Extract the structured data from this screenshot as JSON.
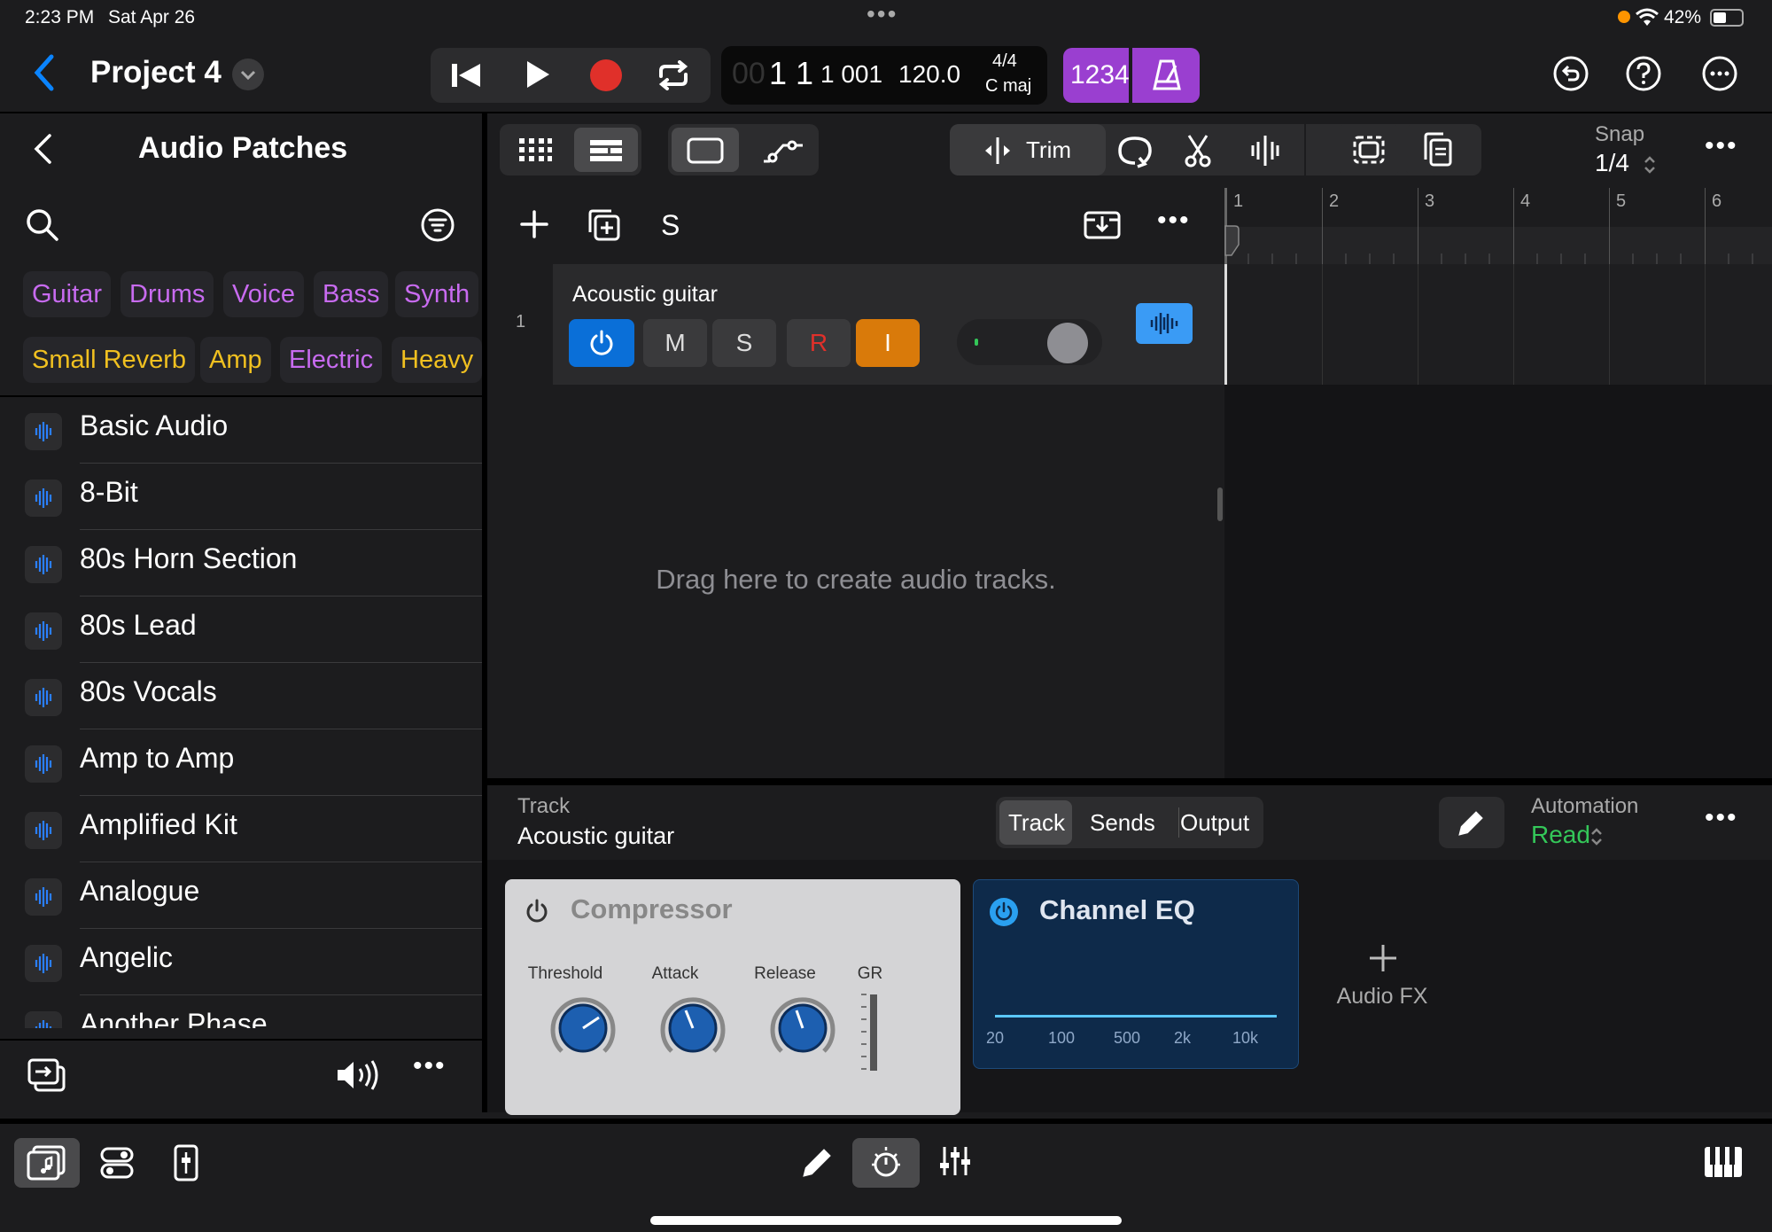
{
  "status_bar": {
    "time": "2:23 PM",
    "date": "Sat Apr 26",
    "battery": "42%"
  },
  "header": {
    "project_title": "Project 4",
    "lcd": {
      "bars_dim": "00",
      "position": "1 1",
      "sub": "1 001",
      "tempo": "120.0",
      "signature": "4/4",
      "key": "C maj"
    },
    "count_in": "1234"
  },
  "left_panel": {
    "title": "Audio Patches",
    "tags": [
      {
        "label": "Guitar",
        "color": "#c86bf0"
      },
      {
        "label": "Drums",
        "color": "#c86bf0"
      },
      {
        "label": "Voice",
        "color": "#c86bf0"
      },
      {
        "label": "Bass",
        "color": "#c86bf0"
      },
      {
        "label": "Synth",
        "color": "#c86bf0"
      },
      {
        "label": "Small Reverb",
        "color": "#f0c020"
      },
      {
        "label": "Amp",
        "color": "#f0c020"
      },
      {
        "label": "Electric",
        "color": "#c86bf0"
      },
      {
        "label": "Heavy",
        "color": "#f0c020"
      }
    ],
    "patches": [
      "Basic Audio",
      "8-Bit",
      "80s Horn Section",
      "80s Lead",
      "80s Vocals",
      "Amp to Amp",
      "Amplified Kit",
      "Analogue",
      "Angelic",
      "Another Phase"
    ]
  },
  "toolbar": {
    "trim_label": "Trim",
    "snap_label": "Snap",
    "snap_value": "1/4"
  },
  "track_header": {
    "solo_label": "S"
  },
  "ruler": {
    "bars": [
      "1",
      "2",
      "3",
      "4",
      "5",
      "6"
    ]
  },
  "track": {
    "number": "1",
    "name": "Acoustic guitar",
    "mute": "M",
    "solo": "S",
    "record": "R",
    "input": "I"
  },
  "empty_hint": "Drag here to create audio tracks.",
  "inspector": {
    "caption": "Track",
    "track_name": "Acoustic guitar",
    "tabs": [
      "Track",
      "Sends",
      "Output"
    ],
    "automation_label": "Automation",
    "automation_value": "Read"
  },
  "plugins": {
    "compressor": {
      "title": "Compressor",
      "knobs": [
        "Threshold",
        "Attack",
        "Release"
      ],
      "gr_label": "GR"
    },
    "channel_eq": {
      "title": "Channel EQ",
      "freqs": [
        "20",
        "100",
        "500",
        "2k",
        "10k"
      ]
    },
    "add_label": "Audio FX"
  },
  "colors": {
    "accent_blue": "#0a6fd8",
    "input_orange": "#d97a0a",
    "record_red": "#e0302a",
    "purple": "#9a3fd0",
    "automation_green": "#34c759"
  }
}
